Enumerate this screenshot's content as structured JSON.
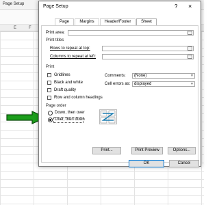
{
  "excel": {
    "window_title": "Page Setup",
    "columns": [
      "E",
      "F"
    ]
  },
  "dialog": {
    "title": "Page Setup",
    "help_label": "?",
    "close_label": "×",
    "tabs": [
      {
        "label": "Page",
        "active": false
      },
      {
        "label": "Margins",
        "active": false
      },
      {
        "label": "Header/Footer",
        "active": false
      },
      {
        "label": "Sheet",
        "active": true
      }
    ],
    "print_area_label": "Print area:",
    "print_area_value": "",
    "print_titles_label": "Print titles",
    "rows_repeat_label": "Rows to repeat at top:",
    "rows_repeat_value": "",
    "cols_repeat_label": "Columns to repeat at left:",
    "cols_repeat_value": "",
    "print_section_label": "Print",
    "checkboxes": [
      {
        "label": "Gridlines",
        "checked": false
      },
      {
        "label": "Black and white",
        "checked": false
      },
      {
        "label": "Draft quality",
        "checked": false
      },
      {
        "label": "Row and column headings",
        "checked": false
      }
    ],
    "comments_label": "Comments:",
    "comments_value": "(None)",
    "cell_errors_label": "Cell errors as:",
    "cell_errors_value": "displayed",
    "page_order_label": "Page order",
    "page_order_options": [
      {
        "label": "Down, then over",
        "selected": false
      },
      {
        "label": "Over, then down",
        "selected": true
      }
    ],
    "print_button": "Print...",
    "print_preview_button": "Print Preview",
    "options_button": "Options...",
    "ok_button": "OK",
    "cancel_button": "Cancel"
  },
  "colors": {
    "arrow": "#1c9e1c",
    "arrow_outline": "#0a4a0a",
    "preview_arrow": "#1e7fb3",
    "ok_border": "#0078d7"
  },
  "icons": {
    "ref_icon": "collapse-dialog-icon",
    "pointer": "green-arrow-icon",
    "preview": "page-order-preview-icon"
  }
}
